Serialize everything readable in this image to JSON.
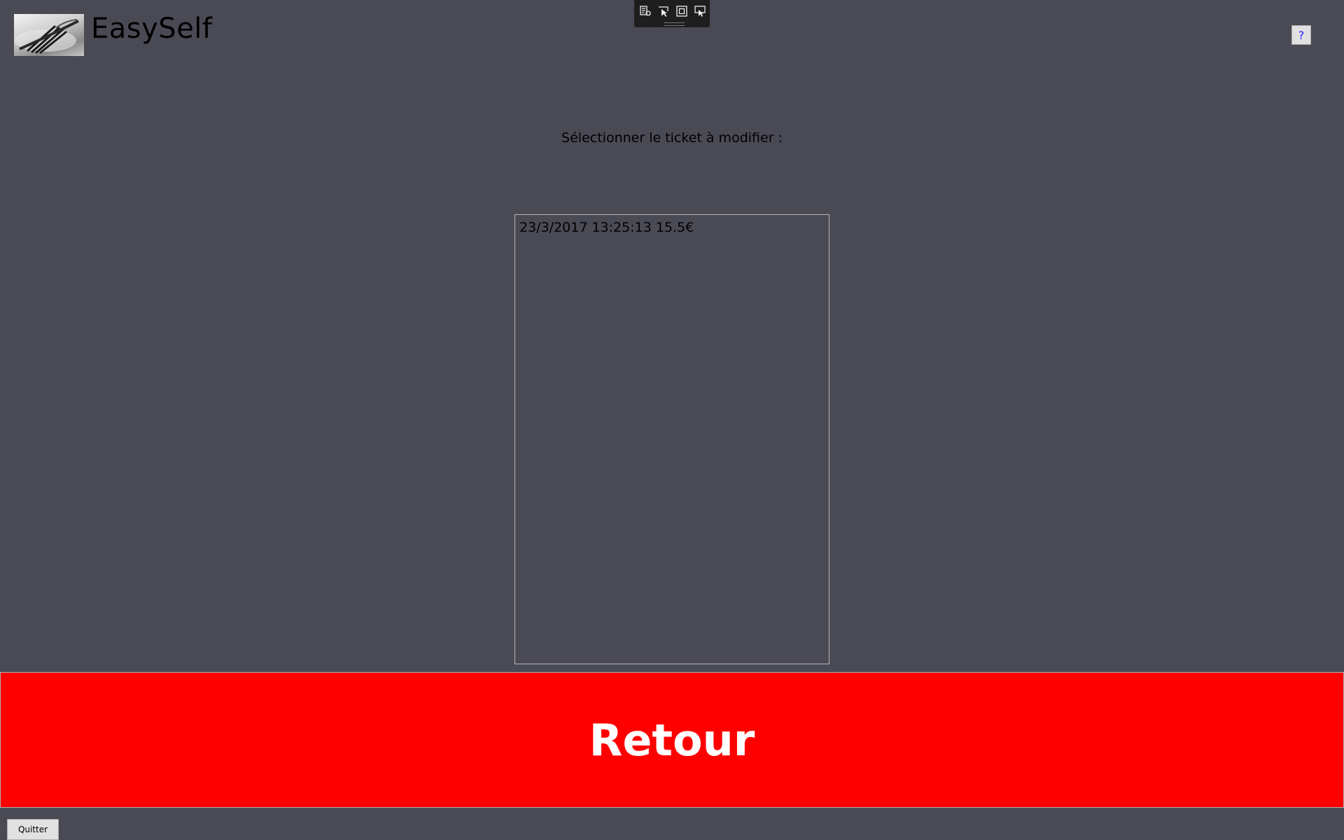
{
  "header": {
    "app_title": "EasySelf",
    "logo_icon": "cutlery-fork-icon",
    "help_label": "?"
  },
  "devtools_toolbar": {
    "icons": [
      "live-visual-tree-icon",
      "select-element-icon",
      "display-layout-adorners-icon",
      "track-focus-icon"
    ]
  },
  "main": {
    "prompt": "Sélectionner le ticket à modifier :",
    "tickets": [
      {
        "label": "23/3/2017 13:25:13 15.5€"
      }
    ]
  },
  "actions": {
    "back_label": "Retour",
    "quit_label": "Quitter"
  },
  "colors": {
    "background": "#4a4a55",
    "back_button": "#ff0000",
    "back_text": "#ffffff",
    "help_text": "#1a1aff"
  }
}
